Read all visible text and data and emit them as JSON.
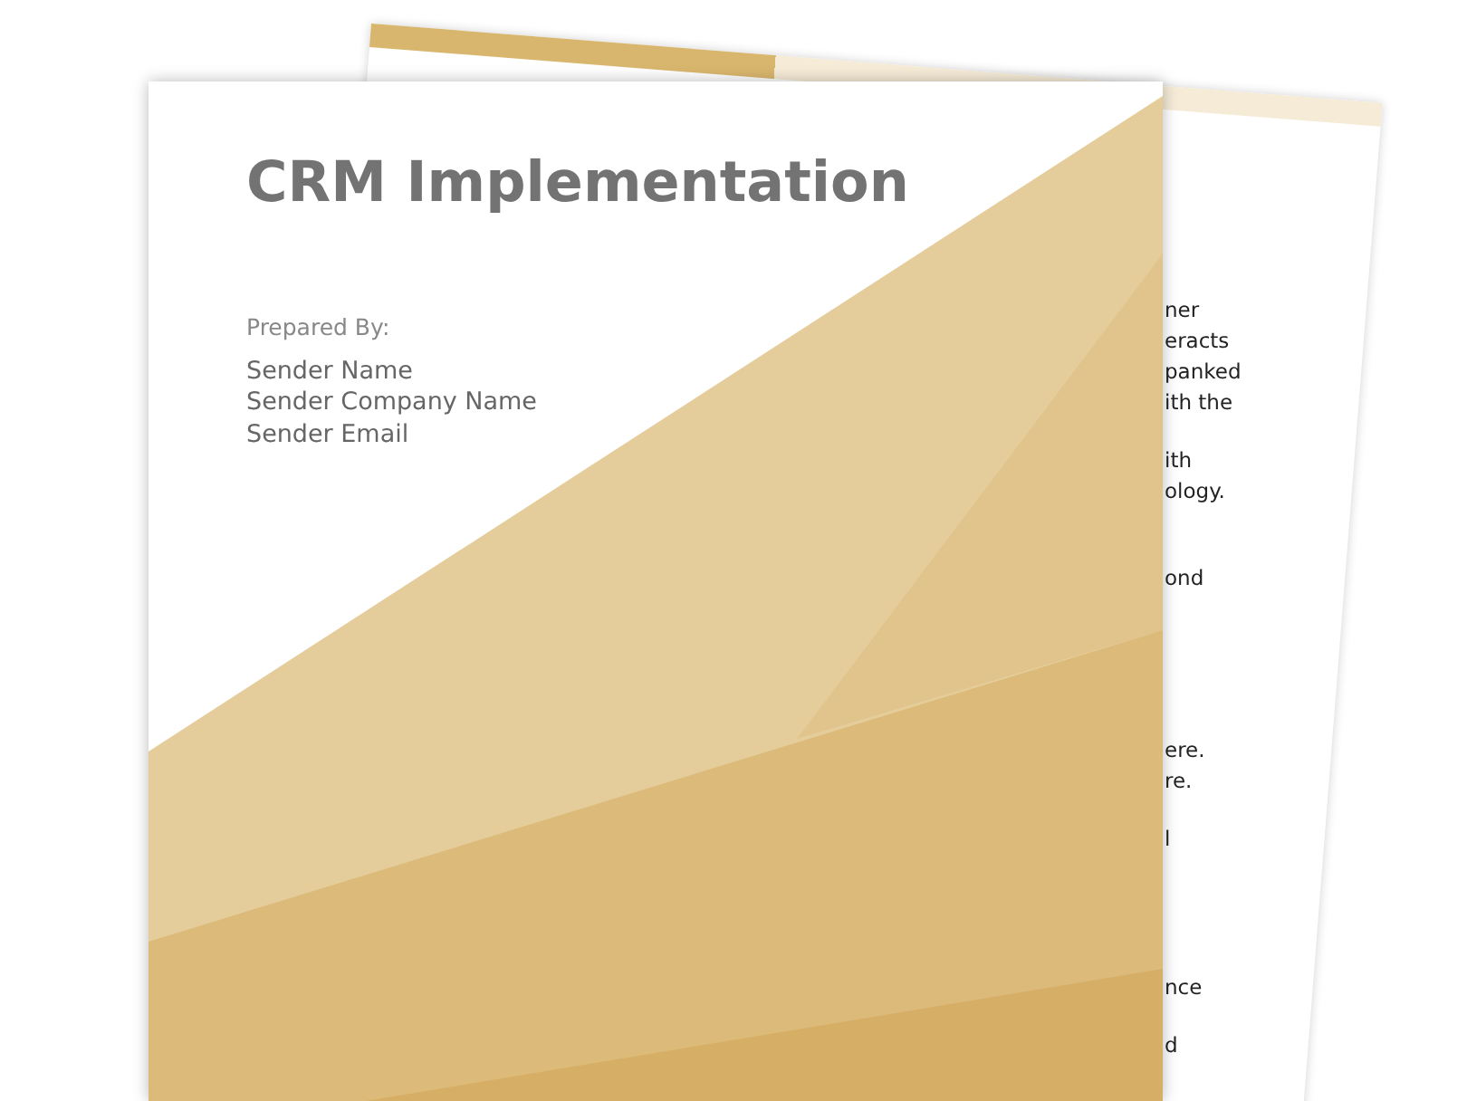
{
  "back_page": {
    "paragraphs": [
      [
        "ner",
        "eracts",
        "panked",
        "ith the"
      ],
      [
        "ith",
        "ology."
      ],
      [
        "ond"
      ],
      [
        "ere.",
        "re."
      ],
      [
        "l"
      ],
      [
        "nce"
      ],
      [
        "d"
      ]
    ]
  },
  "front_page": {
    "title": "CRM Implementation",
    "prepared_by_label": "Prepared By:",
    "sender_lines": [
      "Sender Name",
      "Sender Company Name",
      "Sender Email"
    ]
  }
}
